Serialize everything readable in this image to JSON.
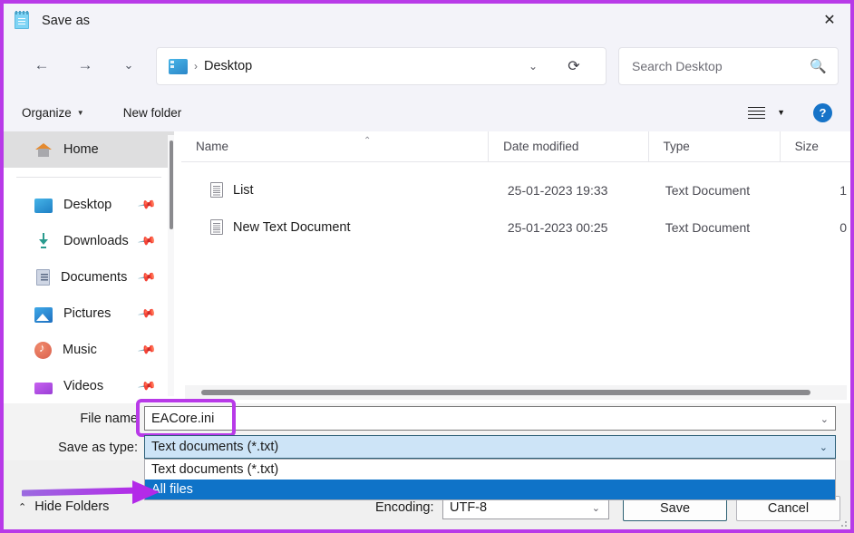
{
  "window": {
    "title": "Save as",
    "app_icon": "notepad-icon",
    "close_label": "✕",
    "accent_annotation_color": "#b83ae8"
  },
  "nav": {
    "back": "←",
    "forward": "→",
    "recent": "⌄",
    "up": "↑",
    "address_crumb": "Desktop",
    "address_separator": "›",
    "address_chevron": "⌄",
    "refresh": "⟳"
  },
  "search": {
    "placeholder": "Search Desktop",
    "value": "",
    "icon": "search-icon"
  },
  "toolbar": {
    "organize": "Organize",
    "organize_caret": "▼",
    "new_folder": "New folder",
    "view_caret": "▼",
    "help": "?"
  },
  "sidebar": {
    "items": [
      {
        "label": "Home",
        "icon": "home-icon",
        "selected": true,
        "pinned": false
      },
      {
        "label": "Desktop",
        "icon": "desktop-icon",
        "selected": false,
        "pinned": true
      },
      {
        "label": "Downloads",
        "icon": "download-icon",
        "selected": false,
        "pinned": true
      },
      {
        "label": "Documents",
        "icon": "documents-icon",
        "selected": false,
        "pinned": true
      },
      {
        "label": "Pictures",
        "icon": "pictures-icon",
        "selected": false,
        "pinned": true
      },
      {
        "label": "Music",
        "icon": "music-icon",
        "selected": false,
        "pinned": true
      },
      {
        "label": "Videos",
        "icon": "videos-icon",
        "selected": false,
        "pinned": true
      }
    ],
    "pin_glyph": "📌"
  },
  "file_list": {
    "columns": [
      "Name",
      "Date modified",
      "Type",
      "Size"
    ],
    "sort_indicator": "⌃",
    "rows": [
      {
        "name": "List",
        "date": "25-01-2023 19:33",
        "type": "Text Document",
        "size": "1"
      },
      {
        "name": "New Text Document",
        "date": "25-01-2023 00:25",
        "type": "Text Document",
        "size": "0"
      }
    ]
  },
  "form": {
    "file_name_label": "File name",
    "file_name_value": "EACore.ini",
    "file_name_chevron": "⌄",
    "save_as_type_label": "Save as type:",
    "save_as_type_value": "Text documents (*.txt)",
    "save_as_type_chevron": "⌄",
    "dropdown_options": [
      {
        "label": "Text documents (*.txt)",
        "active": false
      },
      {
        "label": "All files",
        "active": true
      }
    ]
  },
  "footer": {
    "hide_folders": "Hide Folders",
    "hide_folders_chevron": "⌃",
    "encoding_label": "Encoding:",
    "encoding_value": "UTF-8",
    "encoding_chevron": "⌄",
    "save": "Save",
    "cancel": "Cancel"
  }
}
